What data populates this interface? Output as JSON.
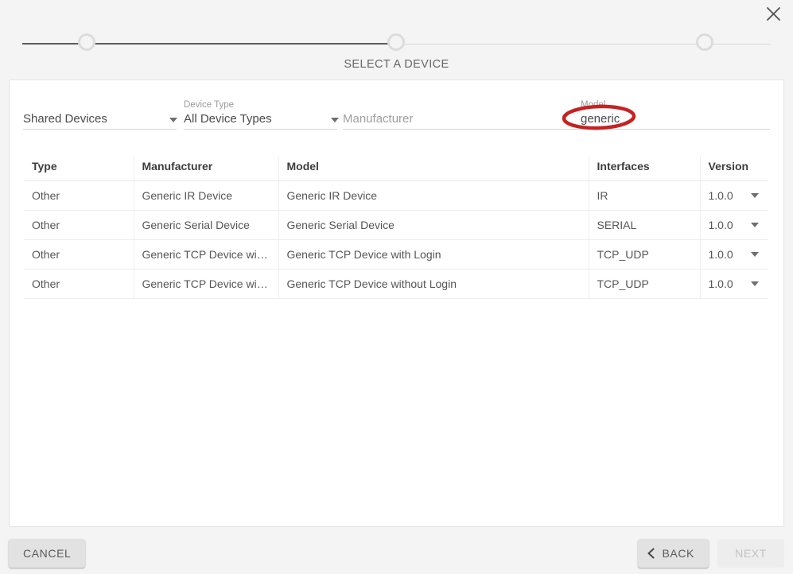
{
  "window": {
    "close_icon": "close-icon"
  },
  "stepper": {
    "steps": [
      {
        "id": "step-1",
        "state": "complete"
      },
      {
        "id": "step-2",
        "state": "current"
      },
      {
        "id": "step-3",
        "state": "upcoming"
      }
    ],
    "title": "SELECT A DEVICE"
  },
  "filters": {
    "scope": {
      "label": "",
      "value": "Shared Devices",
      "caret_icon": "chevron-down-icon"
    },
    "device_type": {
      "label": "Device Type",
      "value": "All Device Types",
      "caret_icon": "chevron-down-icon"
    },
    "manufacturer": {
      "label": "",
      "placeholder": "Manufacturer",
      "value": ""
    },
    "model": {
      "label": "Model",
      "placeholder": "Model",
      "value": "generic"
    }
  },
  "table": {
    "columns": [
      "Type",
      "Manufacturer",
      "Model",
      "Interfaces",
      "Version"
    ],
    "rows": [
      {
        "type": "Other",
        "manufacturer": "Generic IR Device",
        "model": "Generic IR Device",
        "interfaces": "IR",
        "version": "1.0.0"
      },
      {
        "type": "Other",
        "manufacturer": "Generic Serial Device",
        "model": "Generic Serial Device",
        "interfaces": "SERIAL",
        "version": "1.0.0"
      },
      {
        "type": "Other",
        "manufacturer": "Generic TCP Device with...",
        "model": "Generic TCP Device with Login",
        "interfaces": "TCP_UDP",
        "version": "1.0.0"
      },
      {
        "type": "Other",
        "manufacturer": "Generic TCP Device with...",
        "model": "Generic TCP Device without Login",
        "interfaces": "TCP_UDP",
        "version": "1.0.0"
      }
    ]
  },
  "footer": {
    "cancel_label": "CANCEL",
    "back_label": "BACK",
    "back_icon": "chevron-left-icon",
    "next_label": "NEXT",
    "next_disabled": true
  },
  "annotation": {
    "shape": "ellipse",
    "color": "#c62222",
    "target": "generic"
  }
}
